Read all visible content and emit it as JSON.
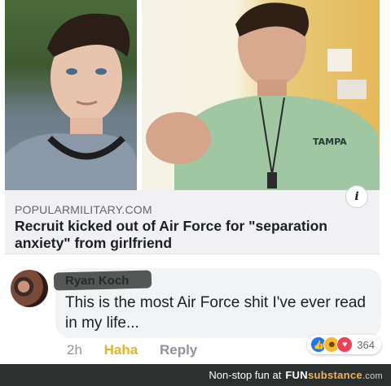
{
  "article": {
    "domain": "POPULARMILITARY.COM",
    "headline": "Recruit kicked out of Air Force for \"separation anxiety\" from girlfriend",
    "info_icon": "info-icon"
  },
  "comment": {
    "author": "Ryan Koch",
    "text": "This is the most Air Force shit I've ever read in my life...",
    "time": "2h",
    "haha_label": "Haha",
    "reply_label": "Reply",
    "reaction_count": "364",
    "reaction_icons": [
      "like-icon",
      "haha-icon",
      "love-icon"
    ]
  },
  "footer": {
    "tagline": "Non-stop fun at",
    "brand_a": "FUN",
    "brand_b": "substance",
    "brand_c": ".com"
  },
  "colors": {
    "like": "#1877f2",
    "haha": "#f7b928",
    "love": "#f33e58",
    "haha_text": "#e4b42a"
  }
}
